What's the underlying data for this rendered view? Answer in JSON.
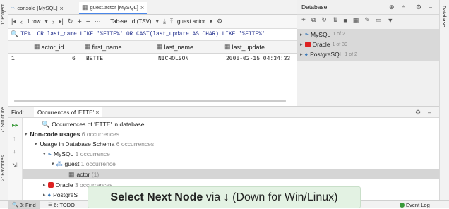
{
  "editor_tabs": [
    {
      "label": "console [MySQL]",
      "icon": "console-icon"
    },
    {
      "label": "guest.actor [MySQL]",
      "icon": "table-icon"
    }
  ],
  "toolbar": {
    "rows": "1 row",
    "format": "Tab-se...d (TSV)",
    "target": "guest.actor"
  },
  "filter_query": "TE%' OR last_name LIKE '%ETTE%' OR CAST(last_update AS CHAR) LIKE '%ETTE%'",
  "grid": {
    "columns": [
      "actor_id",
      "first_name",
      "last_name",
      "last_update"
    ],
    "rows": [
      {
        "num": "1",
        "cells": [
          "6",
          "BETTE",
          "NICHOLSON",
          "2006-02-15 04:34:33"
        ]
      }
    ]
  },
  "database_panel": {
    "title": "Database",
    "side_label": "Database",
    "sources": [
      {
        "name": "MySQL",
        "count": "1 of 2",
        "color": "#3d7ab8"
      },
      {
        "name": "Oracle",
        "count": "1 of 39",
        "color": "#d22"
      },
      {
        "name": "PostgreSQL",
        "count": "1 of 2",
        "color": "#3a79b8"
      }
    ]
  },
  "find_panel": {
    "label": "Find:",
    "tab": "Occurrences of 'ETTE'",
    "tree": {
      "root": "Occurrences of 'ETTE' in database",
      "noncode": "Non-code usages",
      "noncode_count": "6 occurrences",
      "usage": "Usage in Database Schema",
      "usage_count": "6 occurrences",
      "mysql": "MySQL",
      "mysql_count": "1 occurrence",
      "guest": "guest",
      "guest_count": "1 occurrence",
      "actor": "actor",
      "actor_count": "(1)",
      "oracle": "Oracle",
      "oracle_count": "3 occurrences",
      "postgres": "PostgreS"
    }
  },
  "left_tools": {
    "project": "1: Project",
    "structure": "7: Structure",
    "favorites": "2: Favorites"
  },
  "status": {
    "find": "3: Find",
    "todo": "6: TODO",
    "event_log": "Event Log"
  },
  "tooltip": {
    "bold": "Select Next Node",
    "rest": "via ↓ (Down for Win/Linux)"
  }
}
